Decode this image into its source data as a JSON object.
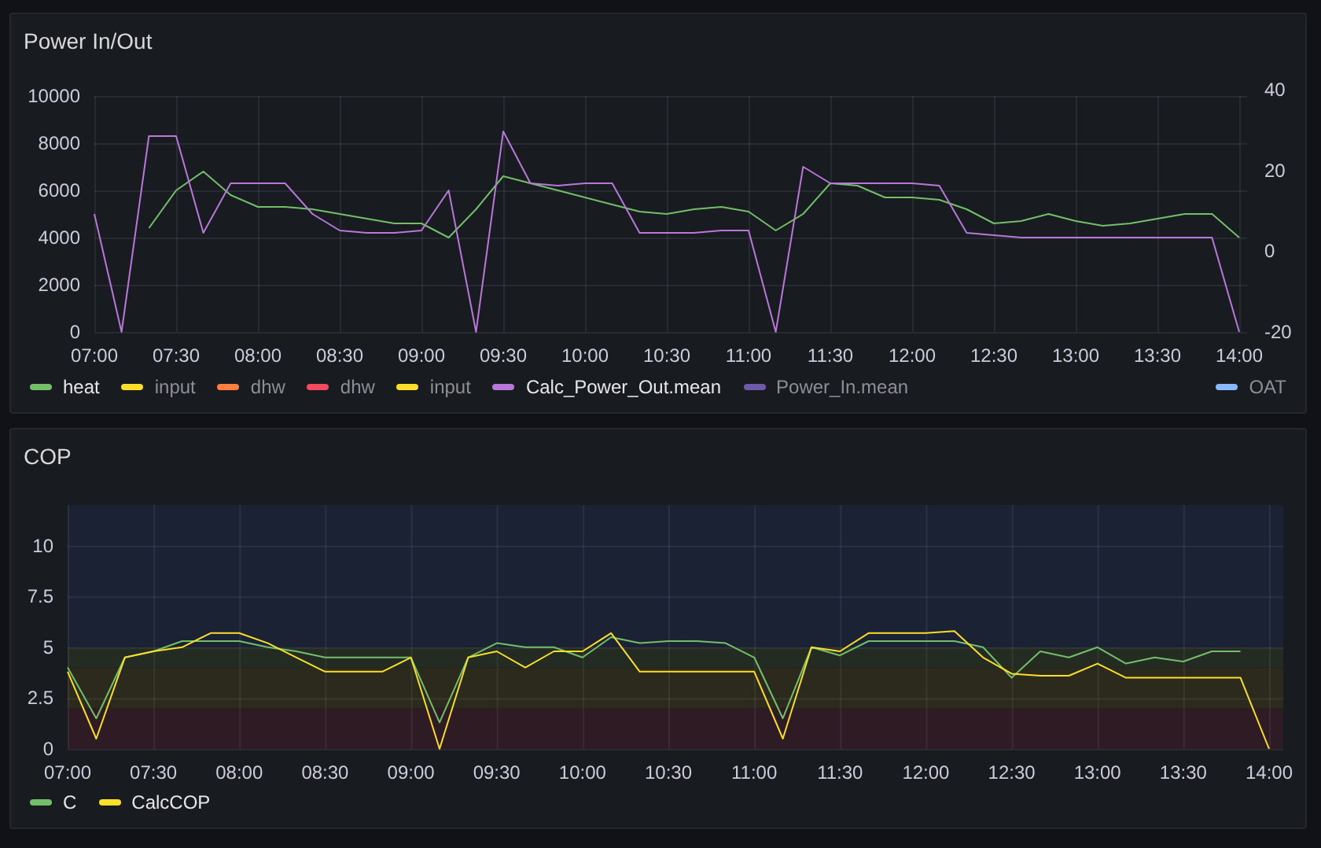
{
  "panels": [
    {
      "title": "Power In/Out",
      "chart_data": {
        "type": "line",
        "categories": [
          "07:00",
          null,
          null,
          "07:30",
          null,
          null,
          "08:00",
          null,
          null,
          "08:30",
          null,
          null,
          "09:00",
          null,
          null,
          "09:30",
          null,
          null,
          "10:00",
          null,
          null,
          "10:30",
          null,
          null,
          "11:00",
          null,
          null,
          "11:30",
          null,
          null,
          "12:00",
          null,
          null,
          "12:30",
          null,
          null,
          "13:00",
          null,
          null,
          "13:30",
          null,
          null,
          "14:00"
        ],
        "ylim": [
          0,
          10000
        ],
        "grid": true,
        "yticks": [
          0,
          2000,
          4000,
          6000,
          8000,
          10000
        ],
        "series": [
          {
            "color": "#73bf69",
            "values": [
              null,
              null,
              4400,
              6000,
              6800,
              5800,
              5300,
              5300,
              5200,
              5000,
              4800,
              4600,
              4600,
              4000,
              5200,
              6600,
              6300,
              6000,
              5700,
              5400,
              5100,
              5000,
              5200,
              5300,
              5100,
              4300,
              5000,
              6300,
              6200,
              5700,
              5700,
              5600,
              5200,
              4600,
              4700,
              5000,
              4700,
              4500,
              4600,
              4800,
              5000,
              5000,
              4000
            ]
          },
          {
            "color": "#b877d9",
            "values": [
              5000,
              0,
              8300,
              8300,
              4200,
              6300,
              6300,
              6300,
              5000,
              4300,
              4200,
              4200,
              4300,
              6000,
              0,
              8500,
              6300,
              6200,
              6300,
              6300,
              4200,
              4200,
              4200,
              4300,
              4300,
              0,
              7000,
              6300,
              6300,
              6300,
              6300,
              6200,
              4200,
              4100,
              4000,
              4000,
              4000,
              4000,
              4000,
              4000,
              4000,
              4000,
              0
            ]
          }
        ]
      },
      "right_axis_ticks": [
        "40",
        "20",
        "0",
        "-20"
      ],
      "legend": [
        {
          "name": "heat",
          "color": "#73bf69",
          "hidden": false,
          "on_right_axis": false
        },
        {
          "name": "input",
          "color": "#fade2a",
          "hidden": true,
          "on_right_axis": false
        },
        {
          "name": "dhw",
          "color": "#ff7f3f",
          "hidden": true,
          "on_right_axis": false
        },
        {
          "name": "dhw",
          "color": "#f2495c",
          "hidden": true,
          "on_right_axis": false
        },
        {
          "name": "input",
          "color": "#fade2a",
          "hidden": true,
          "on_right_axis": false
        },
        {
          "name": "Calc_Power_Out.mean",
          "color": "#b877d9",
          "hidden": false,
          "on_right_axis": false
        },
        {
          "name": "Power_In.mean",
          "color": "#6e5aa6",
          "hidden": true,
          "on_right_axis": false
        },
        {
          "name": "OAT",
          "color": "#8ab8ff",
          "hidden": true,
          "on_right_axis": true
        }
      ]
    },
    {
      "title": "COP",
      "chart_data": {
        "type": "line",
        "categories": [
          "07:00",
          null,
          null,
          "07:30",
          null,
          null,
          "08:00",
          null,
          null,
          "08:30",
          null,
          null,
          "09:00",
          null,
          null,
          "09:30",
          null,
          null,
          "10:00",
          null,
          null,
          "10:30",
          null,
          null,
          "11:00",
          null,
          null,
          "11:30",
          null,
          null,
          "12:00",
          null,
          null,
          "12:30",
          null,
          null,
          "13:00",
          null,
          null,
          "13:30",
          null,
          null,
          "14:00"
        ],
        "ylim": [
          0,
          12
        ],
        "yticks": [
          0,
          2.5,
          5,
          7.5,
          10
        ],
        "grid": true,
        "bands": [
          {
            "axis": "y",
            "from": 0,
            "to": 2,
            "color": "#2e1b24"
          },
          {
            "axis": "y",
            "from": 2,
            "to": 4,
            "color": "#2c2a1c"
          },
          {
            "axis": "y",
            "from": 4,
            "to": 5,
            "color": "#232b22"
          },
          {
            "axis": "y",
            "from": 5,
            "to": 12,
            "color": "#1b2234"
          }
        ],
        "series": [
          {
            "color": "#73bf69",
            "values": [
              4.0,
              1.5,
              4.5,
              4.8,
              5.3,
              5.3,
              5.3,
              5.0,
              4.8,
              4.5,
              4.5,
              4.5,
              4.5,
              1.3,
              4.5,
              5.2,
              5.0,
              5.0,
              4.5,
              5.5,
              5.2,
              5.3,
              5.3,
              5.2,
              4.5,
              1.5,
              5.0,
              4.6,
              5.3,
              5.3,
              5.3,
              5.3,
              5.0,
              3.5,
              4.8,
              4.5,
              5.0,
              4.2,
              4.5,
              4.3,
              4.8,
              4.8,
              null
            ]
          },
          {
            "color": "#fade2a",
            "values": [
              3.8,
              0.5,
              4.5,
              4.8,
              5.0,
              5.7,
              5.7,
              5.2,
              4.5,
              3.8,
              3.8,
              3.8,
              4.5,
              0,
              4.5,
              4.8,
              4.0,
              4.8,
              4.8,
              5.7,
              3.8,
              3.8,
              3.8,
              3.8,
              3.8,
              0.5,
              5.0,
              4.8,
              5.7,
              5.7,
              5.7,
              5.8,
              4.5,
              3.7,
              3.6,
              3.6,
              4.2,
              3.5,
              3.5,
              3.5,
              3.5,
              3.5,
              0
            ]
          }
        ]
      },
      "legend": [
        {
          "name": "C",
          "color": "#73bf69",
          "hidden": false,
          "on_right_axis": false
        },
        {
          "name": "CalcCOP",
          "color": "#fade2a",
          "hidden": false,
          "on_right_axis": false
        }
      ]
    }
  ]
}
